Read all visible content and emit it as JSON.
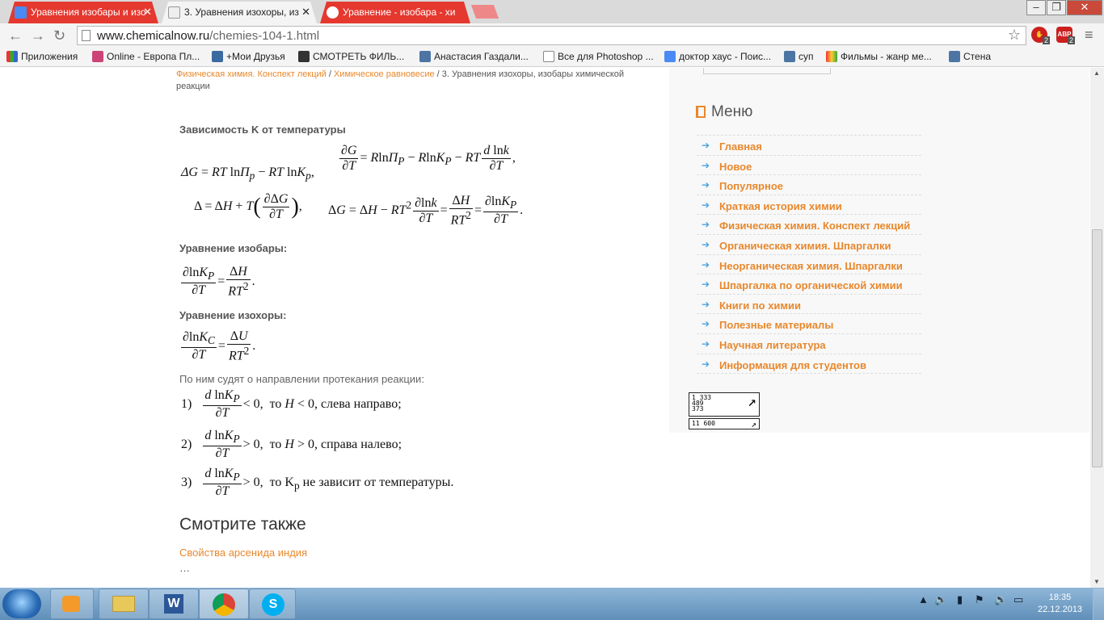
{
  "browser": {
    "tabs": [
      {
        "title": "Уравнения изобары и изо",
        "active": false
      },
      {
        "title": "3. Уравнения изохоры, из",
        "active": true
      },
      {
        "title": "Уравнение - изобара - хи",
        "active": false
      }
    ],
    "url_domain": "www.chemicalnow.ru",
    "url_path": "/chemies-104-1.html",
    "ext_badges": [
      "2",
      "2"
    ],
    "ext_labels": [
      "",
      "ABP"
    ],
    "bookmarks": [
      "Приложения",
      "Online - Европа Пл...",
      "+Мои Друзья",
      "СМОТРЕТЬ ФИЛЬ...",
      "Анастасия Газдали...",
      "Все для Photoshop ...",
      "доктор хаус - Поис...",
      "суп",
      "Фильмы - жанр ме...",
      "Стена"
    ]
  },
  "content": {
    "breadcrumb": {
      "link1": "Физическая химия. Конспект лекций",
      "sep": " / ",
      "link2": "Химическое равновесие",
      "current": "3. Уравнения изохоры, изобары химической реакции"
    },
    "heading_k_temp": "Зависимость K от температуры",
    "heading_isobar": "Уравнение изобары:",
    "heading_isochore": "Уравнение изохоры:",
    "paragraph": "По ним судят о направлении протекания реакции:",
    "conditions": [
      {
        "num": "1)",
        "sign": "< 0,",
        "then": "то",
        "var": "H",
        "cmp": "< 0,",
        "result": "слева направо;"
      },
      {
        "num": "2)",
        "sign": "> 0,",
        "then": "то",
        "var": "H",
        "cmp": "> 0,",
        "result": "справа налево;"
      },
      {
        "num": "3)",
        "sign": "> 0,",
        "then": "то",
        "var": "K",
        "sub": "p",
        "result": "не зависит от температуры."
      }
    ],
    "see_also_title": "Смотрите также",
    "see_also_link": "Свойства арсенида индия",
    "ellipsis": "…"
  },
  "sidebar": {
    "menu_title": "Меню",
    "items": [
      "Главная",
      "Новое",
      "Популярное",
      "Краткая история химии",
      "Физическая химия. Конспект лекций",
      "Органическая химия. Шпаргалки",
      "Неорганическая химия. Шпаргалки",
      "Шпаргалка по органической химии",
      "Книги по химии",
      "Полезные материалы",
      "Научная литература",
      "Информация для студентов"
    ],
    "counter1": [
      "1 333",
      "489",
      "373"
    ],
    "counter2": "11 600"
  },
  "taskbar": {
    "time": "18:35",
    "date": "22.12.2013"
  },
  "colors": {
    "accent": "#e8882c",
    "tab_red": "#e5382f",
    "link_blue_arrow": "#4aa3df"
  }
}
